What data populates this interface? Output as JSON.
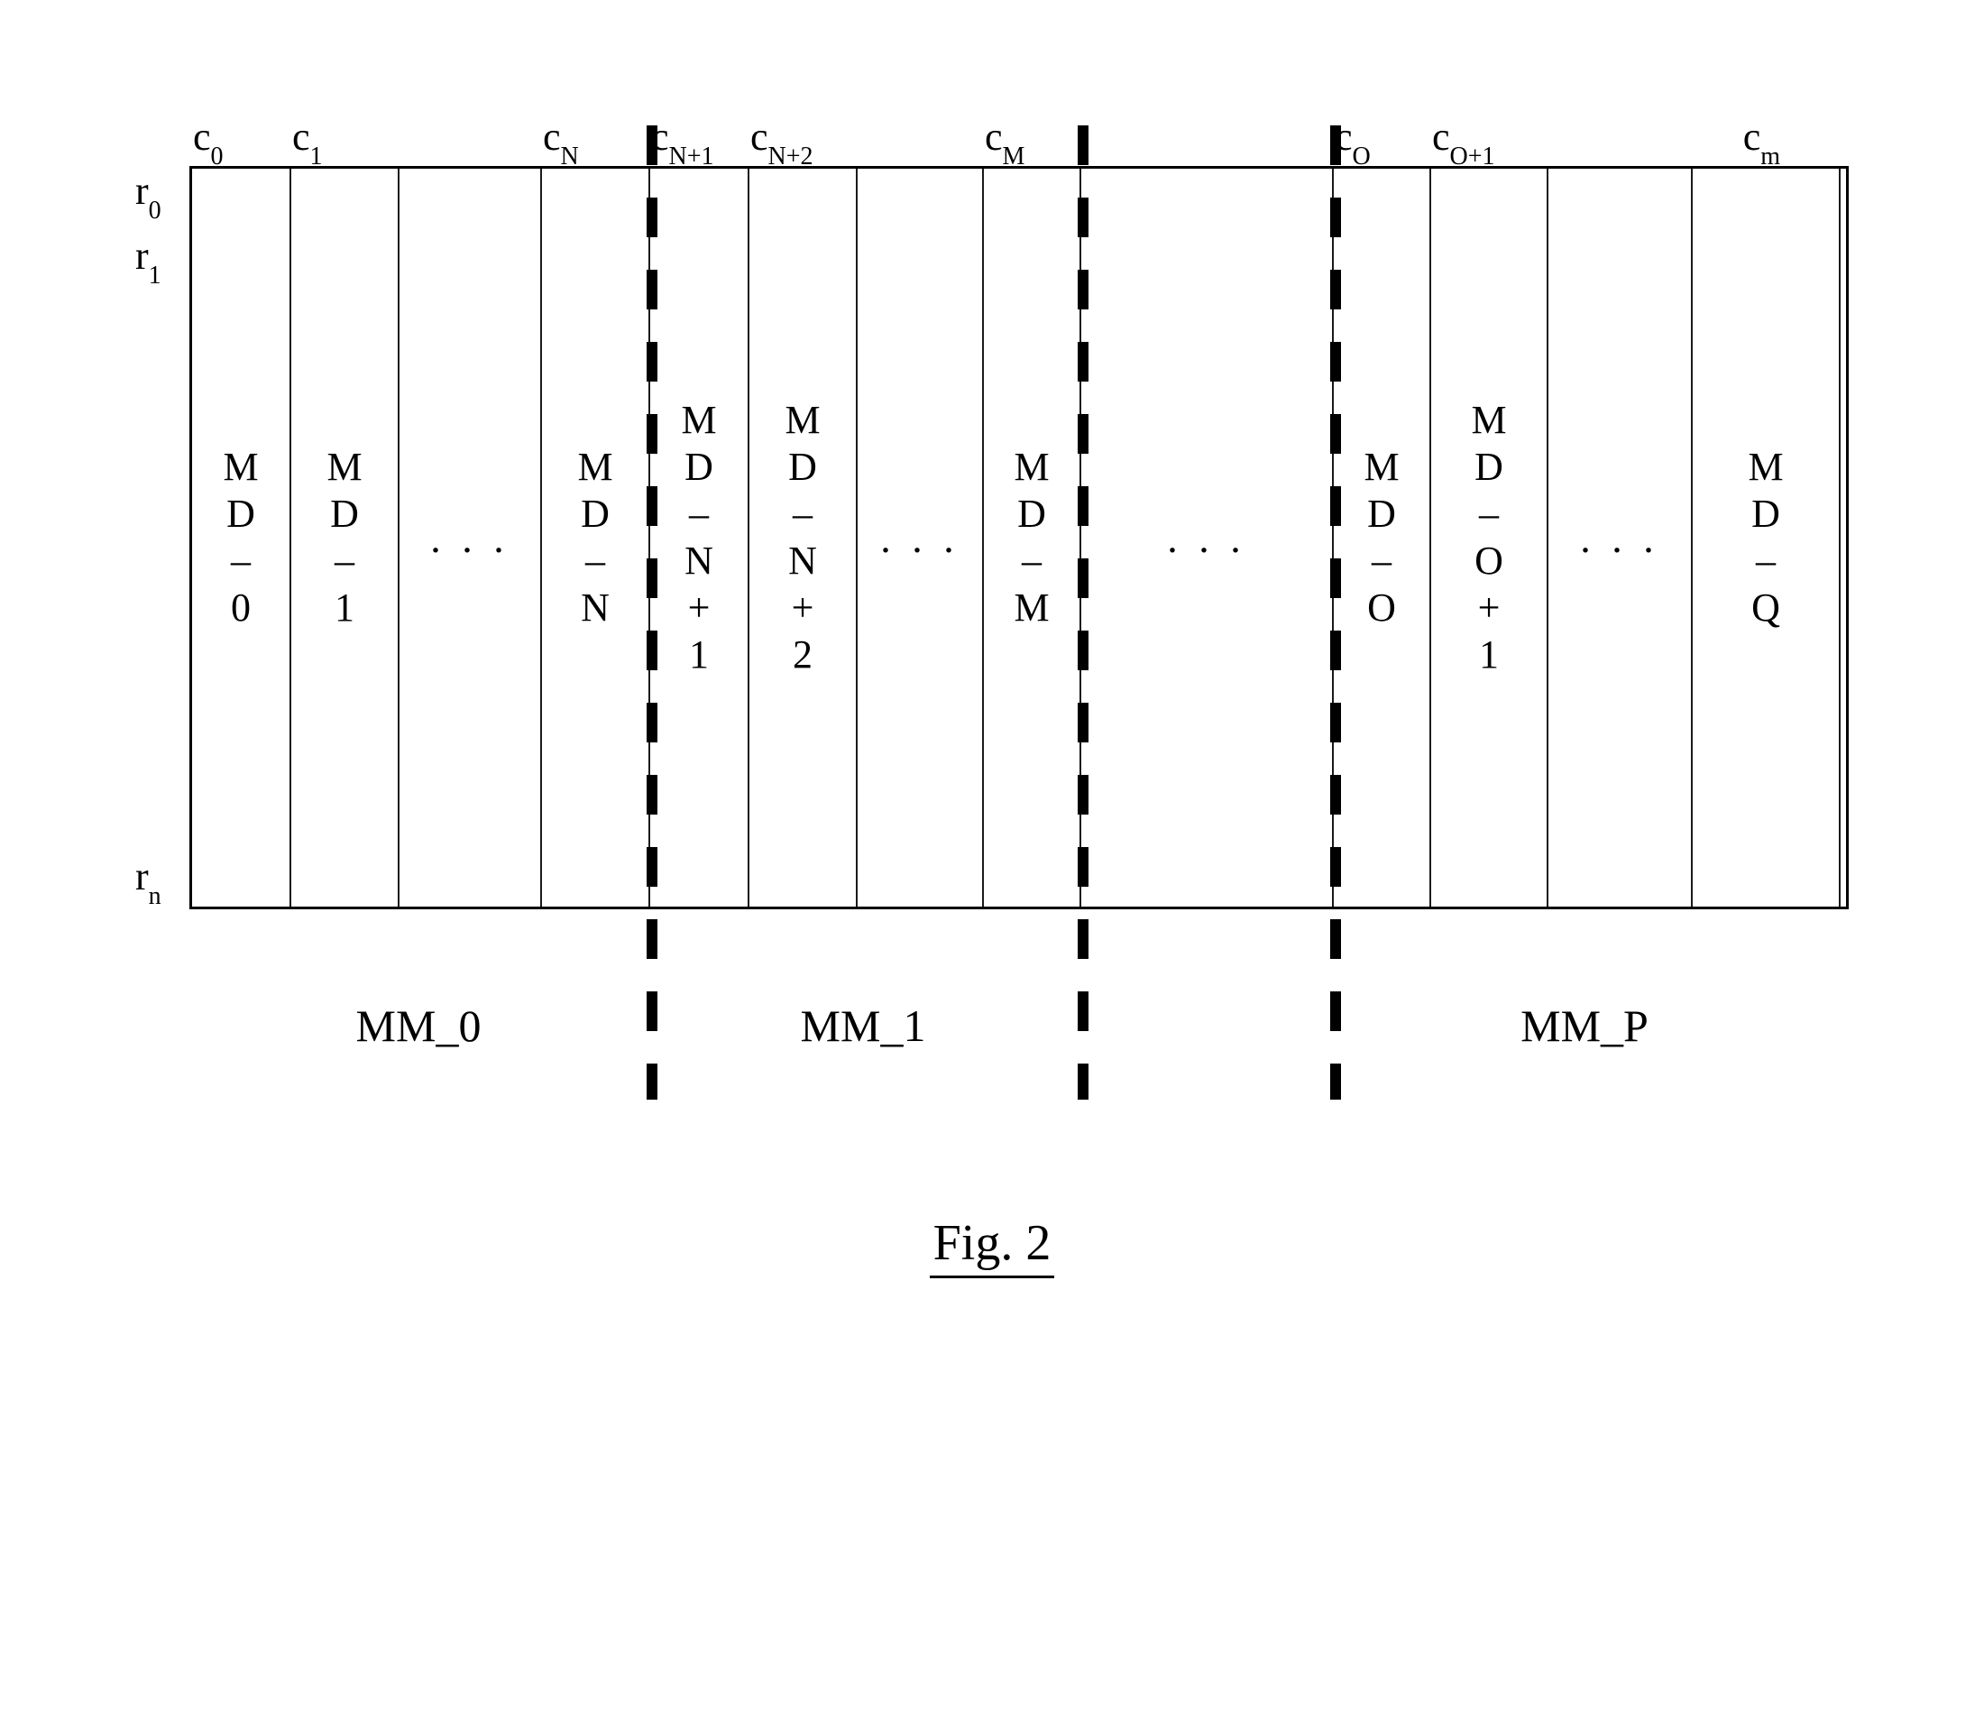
{
  "column_headers": {
    "c0": "c",
    "c0_sub": "0",
    "c1": "c",
    "c1_sub": "1",
    "cN": "c",
    "cN_sub": "N",
    "cN1": "c",
    "cN1_sub": "N+1",
    "cN2": "c",
    "cN2_sub": "N+2",
    "cM": "c",
    "cM_sub": "M",
    "cO": "c",
    "cO_sub": "O",
    "cO1": "c",
    "cO1_sub": "O+1",
    "cm": "c",
    "cm_sub": "m"
  },
  "row_headers": {
    "r0": "r",
    "r0_sub": "0",
    "r1": "r",
    "r1_sub": "1",
    "rn": "r",
    "rn_sub": "n"
  },
  "cells": {
    "md0_a": "M",
    "md0_b": "D",
    "md0_c": "–",
    "md0_d": "0",
    "md1_a": "M",
    "md1_b": "D",
    "md1_c": "–",
    "md1_d": "1",
    "mdN_a": "M",
    "mdN_b": "D",
    "mdN_c": "–",
    "mdN_d": "N",
    "mdN1_a": "M",
    "mdN1_b": "D",
    "mdN1_c": "–",
    "mdN1_d": "N",
    "mdN1_e": "+",
    "mdN1_f": "1",
    "mdN2_a": "M",
    "mdN2_b": "D",
    "mdN2_c": "–",
    "mdN2_d": "N",
    "mdN2_e": "+",
    "mdN2_f": "2",
    "mdM_a": "M",
    "mdM_b": "D",
    "mdM_c": "–",
    "mdM_d": "M",
    "mdO_a": "M",
    "mdO_b": "D",
    "mdO_c": "–",
    "mdO_d": "O",
    "mdO1_a": "M",
    "mdO1_b": "D",
    "mdO1_c": "–",
    "mdO1_d": "O",
    "mdO1_e": "+",
    "mdO1_f": "1",
    "mdQ_a": "M",
    "mdQ_b": "D",
    "mdQ_c": "–",
    "mdQ_d": "Q",
    "dots": ". . ."
  },
  "modules": {
    "mm0": "MM_0",
    "mm1": "MM_1",
    "mmP": "MM_P"
  },
  "caption": "Fig. 2"
}
